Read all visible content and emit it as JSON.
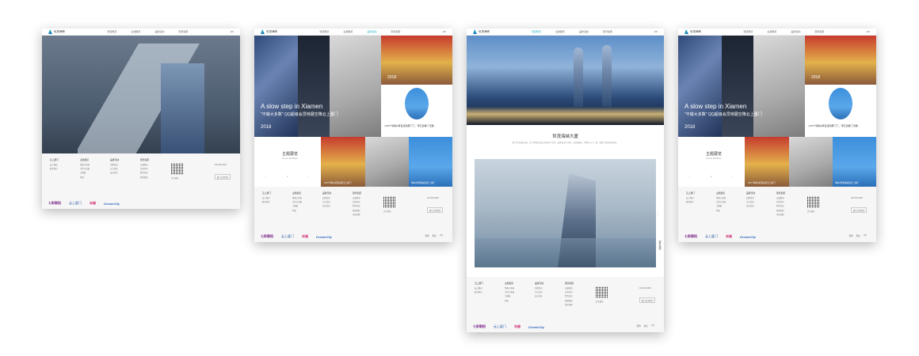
{
  "nav": {
    "brand": "世茂海峡",
    "items": [
      "项目概况",
      "主题展览",
      "品牌活动",
      "观景指南"
    ],
    "lang": "EN"
  },
  "page1": {
    "thumb_caption": "世茂海峡大厦"
  },
  "page2": {
    "headline": "A slow step in Xiamen",
    "subline": "\"不做大多数\" QQ超级会员特展空降云上厦门",
    "year": "2018",
    "card_year": "2018",
    "card_text": "| 100个哆啦A梦爱来到厦门了，带它去看了无数...",
    "small_text": "哆啦A梦特展来到云上厦门",
    "theme_title": "主题展览",
    "theme_sub": "Theme Exhibition",
    "pager": "1",
    "caption_a": "100个哆啦A梦爱来到云上厦门",
    "caption_b": "哆啦A梦特展来到云上厦门"
  },
  "page3": {
    "title": "世茂海峡大厦",
    "desc": "厦门世茂海峡大厦，位于思明区演武大桥观光平台旁，集超高层写字楼、五星级酒店、购物中心于一体，是厦门的城市新地标。",
    "side_label": "观景指南"
  },
  "footer": {
    "cols": [
      {
        "h": "云上厦门",
        "links": [
          "云上概况",
          "联系我们"
        ]
      },
      {
        "h": "主题展览",
        "links": [
          "经典艺术展",
          "当代艺术展",
          "主题展",
          "特展"
        ]
      },
      {
        "h": "品牌活动",
        "links": [
          "品牌活动",
          "节日活动",
          "会员活动"
        ]
      },
      {
        "h": "观景指南",
        "links": [
          "交通指南",
          "开放时间",
          "票务信息",
          "参观须知",
          "常见问题"
        ]
      }
    ],
    "qr_label": "官方微信",
    "contact": "400-000-0000",
    "address": "厦门市思明区",
    "brands": [
      "七彩朝阳",
      "云上厦门",
      "米缇",
      "DreamCity"
    ],
    "share": [
      "微博",
      "微信",
      "QQ"
    ]
  }
}
